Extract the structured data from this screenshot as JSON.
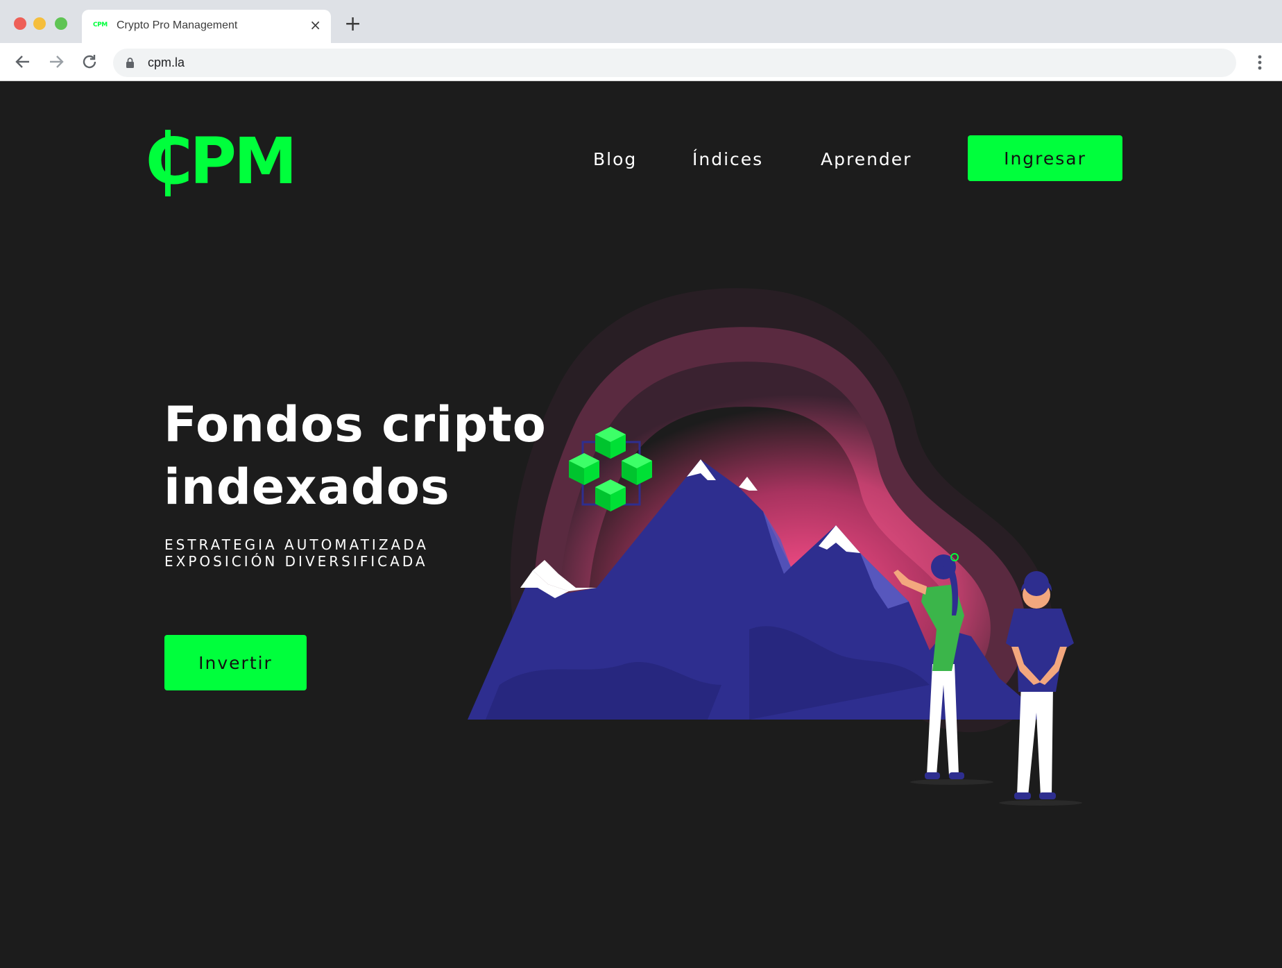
{
  "browser": {
    "tab": {
      "favicon_text": "CPM",
      "title": "Crypto Pro Management",
      "close_label": "×"
    },
    "new_tab_label": "+",
    "url": "cpm.la"
  },
  "site": {
    "logo": "CPM",
    "nav": [
      {
        "label": "Blog"
      },
      {
        "label": "Índices"
      },
      {
        "label": "Aprender"
      }
    ],
    "login_button": "Ingresar"
  },
  "hero": {
    "title_line1": "Fondos cripto",
    "title_line2": "indexados",
    "subtitle_line1": "ESTRATEGIA AUTOMATIZADA",
    "subtitle_line2": "EXPOSICIÓN DIVERSIFICADA",
    "cta": "Invertir"
  },
  "colors": {
    "accent": "#00ff3c",
    "background": "#1c1c1c",
    "mountain": "#2e2e8f",
    "glow": "#ff4f8b"
  }
}
